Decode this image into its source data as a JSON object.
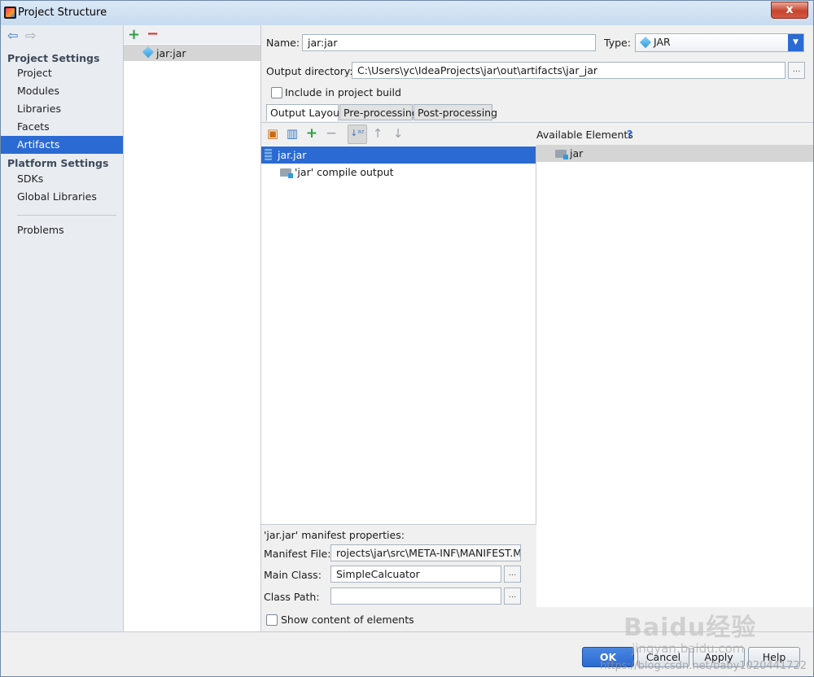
{
  "window": {
    "title": "Project Structure",
    "close_glyph": "x"
  },
  "nav": {
    "sections": [
      {
        "heading": "Project Settings",
        "items": [
          "Project",
          "Modules",
          "Libraries",
          "Facets",
          "Artifacts"
        ]
      },
      {
        "heading": "Platform Settings",
        "items": [
          "SDKs",
          "Global Libraries"
        ]
      }
    ],
    "problems": "Problems",
    "selected": "Artifacts"
  },
  "artifact_list": {
    "items": [
      "jar:jar"
    ]
  },
  "form": {
    "name_label": "Name:",
    "name_value": "jar:jar",
    "type_label": "Type:",
    "type_value": "JAR",
    "output_dir_label": "Output directory:",
    "output_dir_value": "C:\\Users\\yc\\IdeaProjects\\jar\\out\\artifacts\\jar_jar",
    "include_build_label": "Include in project build",
    "include_build_checked": false,
    "browse_glyph": "..."
  },
  "tabs": [
    "Output Layout",
    "Pre-processing",
    "Post-processing"
  ],
  "layout_tree": [
    {
      "label": "jar.jar",
      "selected": true
    },
    {
      "label": "'jar' compile output",
      "selected": false
    }
  ],
  "available": {
    "heading": "Available Elements",
    "help": "?",
    "items": [
      "jar"
    ]
  },
  "manifest": {
    "heading": "'jar.jar' manifest properties:",
    "manifest_file_label": "Manifest File:",
    "manifest_file_value": "rojects\\jar\\src\\META-INF\\MANIFEST.MF",
    "main_class_label": "Main Class:",
    "main_class_value": "SimpleCalcuator",
    "class_path_label": "Class Path:",
    "class_path_value": "",
    "show_content_label": "Show content of elements",
    "show_content_glyph": "..."
  },
  "buttons": {
    "ok": "OK",
    "cancel": "Cancel",
    "apply": "Apply",
    "help": "Help"
  },
  "watermark": {
    "url": "https://blog.csdn.net/baby1020441722",
    "brand": "Baidu经验",
    "brand_sub": "jingyan.baidu.com"
  }
}
